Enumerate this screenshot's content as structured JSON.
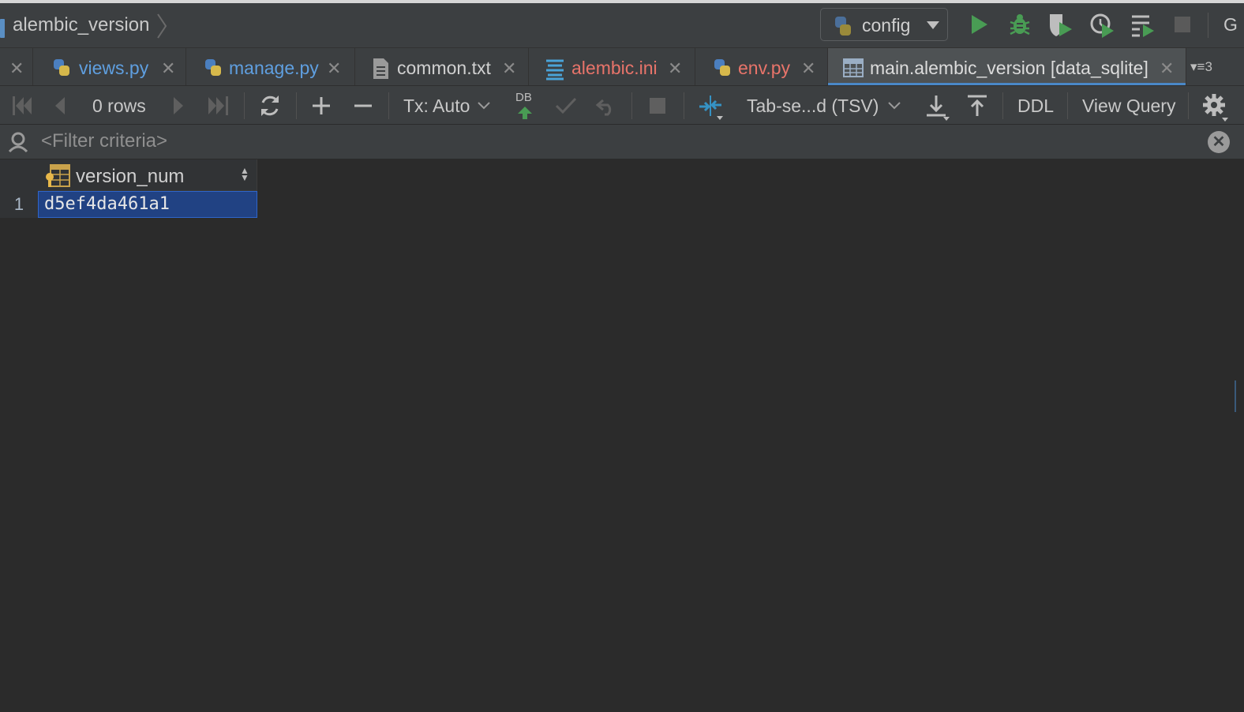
{
  "navbar": {
    "breadcrumb": "alembic_version",
    "run_config": "config",
    "overflow_letter": "G"
  },
  "tabs": [
    {
      "label": "views.py",
      "icon": "python-file-icon",
      "color": "#5f9fe0"
    },
    {
      "label": "manage.py",
      "icon": "python-file-icon",
      "color": "#5f9fe0"
    },
    {
      "label": "common.txt",
      "icon": "text-file-icon",
      "color": "#d0d0d0"
    },
    {
      "label": "alembic.ini",
      "icon": "ini-file-icon",
      "color": "#e8746a"
    },
    {
      "label": "env.py",
      "icon": "python-file-icon",
      "color": "#e8746a"
    },
    {
      "label": "main.alembic_version [data_sqlite]",
      "icon": "table-icon",
      "color": "#d0d0d0",
      "active": true
    }
  ],
  "tab_overflow_count": "3",
  "toolbar": {
    "rows": "0 rows",
    "tx_mode": "Tx: Auto",
    "db_label": "DB",
    "export_format": "Tab-se...d (TSV)",
    "ddl": "DDL",
    "view_query": "View Query"
  },
  "filter": {
    "placeholder": "<Filter criteria>"
  },
  "table": {
    "columns": [
      "version_num"
    ],
    "rows": [
      {
        "num": "1",
        "cells": [
          "d5ef4da461a1"
        ]
      }
    ]
  },
  "colors": {
    "background": "#2b2b2b",
    "panel": "#3c3f41",
    "accent": "#4a88c7",
    "run_green": "#499c54",
    "selection": "#214283"
  }
}
